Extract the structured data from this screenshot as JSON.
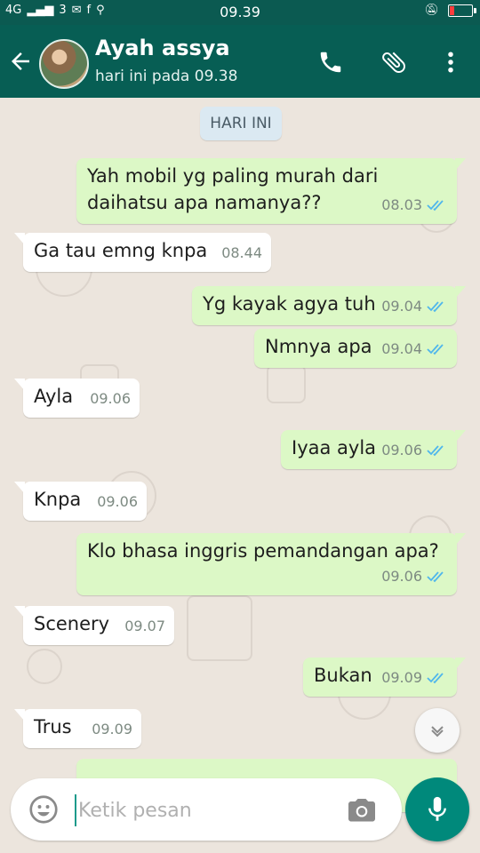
{
  "status": {
    "time": "09.39",
    "carrier": "4G",
    "network_digit": "3",
    "battery_level": 0.2,
    "battery_color": "#ff3d3d"
  },
  "header": {
    "contact_name": "Ayah assya",
    "last_seen": "hari ini pada 09.38"
  },
  "chat": {
    "day_label": "HARI INI",
    "messages": [
      {
        "dir": "out",
        "lines": [
          "Yah mobil yg paling murah dari",
          "daihatsu apa namanya??"
        ],
        "time": "08.03",
        "ticks": "read"
      },
      {
        "dir": "in",
        "lines": [
          "Ga tau emng knpa"
        ],
        "time": "08.44"
      },
      {
        "dir": "out",
        "lines": [
          "Yg kayak agya tuh"
        ],
        "time": "09.04",
        "ticks": "read"
      },
      {
        "dir": "out",
        "lines": [
          "Nmnya apa"
        ],
        "time": "09.04",
        "ticks": "read"
      },
      {
        "dir": "in",
        "lines": [
          "Ayla"
        ],
        "time": "09.06"
      },
      {
        "dir": "out",
        "lines": [
          "Iyaa ayla"
        ],
        "time": "09.06",
        "ticks": "read"
      },
      {
        "dir": "in",
        "lines": [
          "Knpa"
        ],
        "time": "09.06"
      },
      {
        "dir": "out",
        "lines": [
          "Klo bhasa inggris pemandangan apa?"
        ],
        "time": "09.06",
        "ticks": "read"
      },
      {
        "dir": "in",
        "lines": [
          "Scenery"
        ],
        "time": "09.07"
      },
      {
        "dir": "out",
        "lines": [
          "Bukan"
        ],
        "time": "09.09",
        "ticks": "read"
      },
      {
        "dir": "in",
        "lines": [
          "Trus"
        ],
        "time": "09.09"
      }
    ]
  },
  "composer": {
    "placeholder": "Ketik pesan",
    "value": ""
  },
  "colors": {
    "header": "#075e54",
    "outgoing": "#dcf8c6",
    "incoming": "#ffffff",
    "read_tick": "#4fb6ec",
    "mic_button": "#00897b"
  },
  "icons": [
    "back-arrow-icon",
    "call-icon",
    "attach-icon",
    "more-vert-icon",
    "emoji-icon",
    "camera-icon",
    "mic-icon",
    "chevron-down-icon",
    "double-check-icon"
  ]
}
